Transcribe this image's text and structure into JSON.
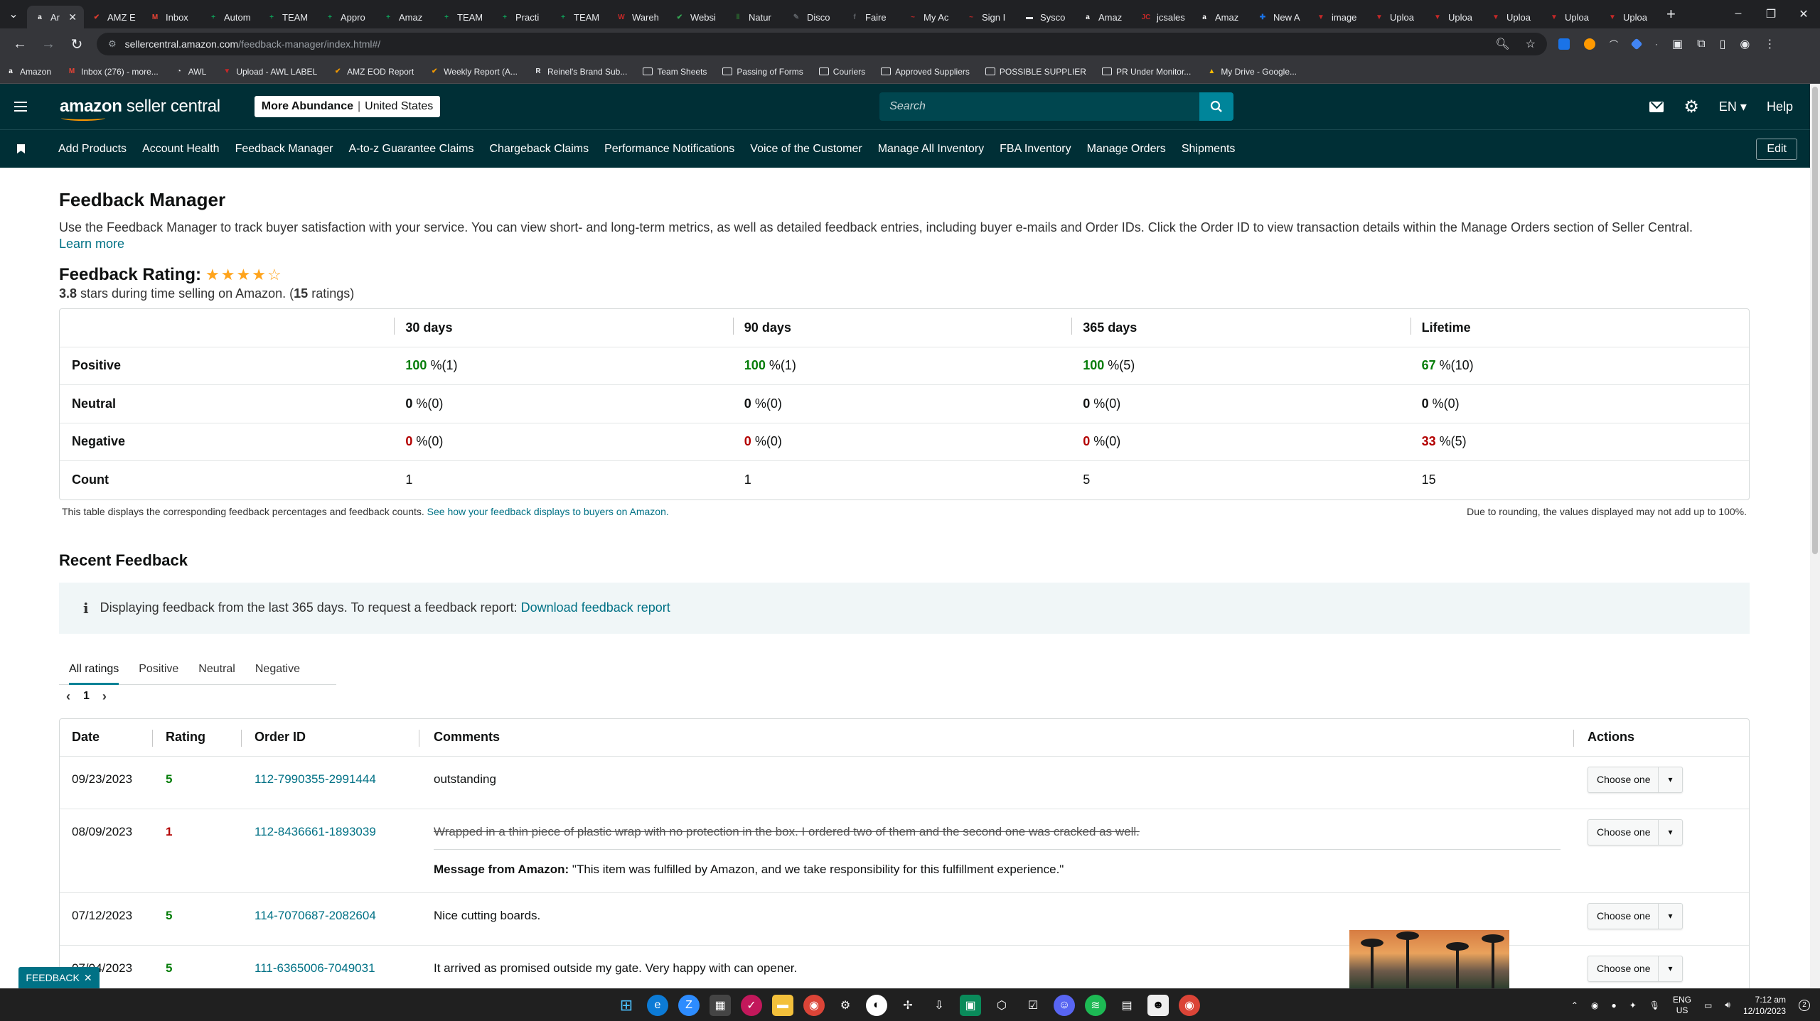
{
  "browser": {
    "tabs": [
      {
        "label": "Ar",
        "fav": "a",
        "color": "#ffffff",
        "active": true
      },
      {
        "label": "AMZ E",
        "fav": "✔",
        "color": "#e23b2e"
      },
      {
        "label": "Inbox",
        "fav": "M",
        "color": "#ea4335"
      },
      {
        "label": "Autom",
        "fav": "+",
        "color": "#0f9d58"
      },
      {
        "label": "TEAM",
        "fav": "+",
        "color": "#0f9d58"
      },
      {
        "label": "Appro",
        "fav": "+",
        "color": "#0f9d58"
      },
      {
        "label": "Amaz",
        "fav": "+",
        "color": "#0f9d58"
      },
      {
        "label": "TEAM",
        "fav": "+",
        "color": "#0f9d58"
      },
      {
        "label": "Practi",
        "fav": "+",
        "color": "#0f9d58"
      },
      {
        "label": "TEAM",
        "fav": "+",
        "color": "#0f9d58"
      },
      {
        "label": "Wareh",
        "fav": "W",
        "color": "#c62828"
      },
      {
        "label": "Websi",
        "fav": "✔",
        "color": "#34a853"
      },
      {
        "label": "Natur",
        "fav": "‖",
        "color": "#2e7d32"
      },
      {
        "label": "Disco",
        "fav": "✎",
        "color": "#5f6368"
      },
      {
        "label": "Faire",
        "fav": "f",
        "color": "#5f6368"
      },
      {
        "label": "My Ac",
        "fav": "~",
        "color": "#c62828"
      },
      {
        "label": "Sign I",
        "fav": "~",
        "color": "#c62828"
      },
      {
        "label": "Sysco",
        "fav": "▬",
        "color": "#e8eaed"
      },
      {
        "label": "Amaz",
        "fav": "a",
        "color": "#ffffff"
      },
      {
        "label": "jcsales",
        "fav": "JC",
        "color": "#c62828"
      },
      {
        "label": "Amaz",
        "fav": "a",
        "color": "#ffffff"
      },
      {
        "label": "New A",
        "fav": "✚",
        "color": "#1a73e8"
      },
      {
        "label": "image",
        "fav": "▼",
        "color": "#c62828"
      },
      {
        "label": "Uploa",
        "fav": "▼",
        "color": "#c62828"
      },
      {
        "label": "Uploa",
        "fav": "▼",
        "color": "#c62828"
      },
      {
        "label": "Uploa",
        "fav": "▼",
        "color": "#c62828"
      },
      {
        "label": "Uploa",
        "fav": "▼",
        "color": "#c62828"
      },
      {
        "label": "Uploa",
        "fav": "▼",
        "color": "#c62828"
      }
    ],
    "url_host": "sellercentral.amazon.com",
    "url_path": "/feedback-manager/index.html#/",
    "bookmarks": [
      {
        "label": "Amazon",
        "type": "icon",
        "color": "#ffffff",
        "glyph": "a"
      },
      {
        "label": "Inbox (276) - more...",
        "type": "icon",
        "color": "#ea4335",
        "glyph": "M"
      },
      {
        "label": "AWL",
        "type": "icon",
        "color": "#e8eaed",
        "glyph": "◔"
      },
      {
        "label": "Upload - AWL LABEL",
        "type": "icon",
        "color": "#c62828",
        "glyph": "▼"
      },
      {
        "label": "AMZ EOD Report",
        "type": "icon",
        "color": "#f29900",
        "glyph": "✔"
      },
      {
        "label": "Weekly Report (A...",
        "type": "icon",
        "color": "#f29900",
        "glyph": "✔"
      },
      {
        "label": "Reinel's Brand Sub...",
        "type": "icon",
        "color": "#e8eaed",
        "glyph": "R"
      },
      {
        "label": "Team Sheets",
        "type": "folder"
      },
      {
        "label": "Passing of Forms",
        "type": "folder"
      },
      {
        "label": "Couriers",
        "type": "folder"
      },
      {
        "label": "Approved Suppliers",
        "type": "folder"
      },
      {
        "label": "POSSIBLE SUPPLIER",
        "type": "folder"
      },
      {
        "label": "PR Under Monitor...",
        "type": "folder"
      },
      {
        "label": "My Drive - Google...",
        "type": "icon",
        "color": "#fbbc04",
        "glyph": "▲"
      }
    ]
  },
  "header": {
    "logo_bold": "amazon",
    "logo_rest": " seller central",
    "store_name": "More Abundance",
    "marketplace": "United States",
    "search_placeholder": "Search",
    "language": "EN ▾",
    "help": "Help"
  },
  "nav": {
    "links": [
      "Add Products",
      "Account Health",
      "Feedback Manager",
      "A-to-z Guarantee Claims",
      "Chargeback Claims",
      "Performance Notifications",
      "Voice of the Customer",
      "Manage All Inventory",
      "FBA Inventory",
      "Manage Orders",
      "Shipments"
    ],
    "edit": "Edit"
  },
  "page": {
    "title": "Feedback Manager",
    "intro": "Use the Feedback Manager to track buyer satisfaction with your service. You can view short- and long-term metrics, as well as detailed feedback entries, including buyer e-mails and Order IDs. Click the Order ID to view transaction details within the Manage Orders section of Seller Central.",
    "learn_more": "Learn more",
    "rating_title": "Feedback Rating:",
    "stars": 3.8,
    "rating_value": "3.8",
    "rating_text_a": " stars during time selling on Amazon. (",
    "rating_count": "15",
    "rating_text_b": " ratings)"
  },
  "metrics": {
    "columns": [
      "30 days",
      "90 days",
      "365 days",
      "Lifetime"
    ],
    "rows": [
      {
        "label": "Positive",
        "kind": "pos",
        "cells": [
          {
            "v": "100",
            "n": " %(1)"
          },
          {
            "v": "100",
            "n": " %(1)"
          },
          {
            "v": "100",
            "n": " %(5)"
          },
          {
            "v": "67",
            "n": " %(10)"
          }
        ]
      },
      {
        "label": "Neutral",
        "kind": "zero",
        "cells": [
          {
            "v": "0",
            "n": " %(0)"
          },
          {
            "v": "0",
            "n": " %(0)"
          },
          {
            "v": "0",
            "n": " %(0)"
          },
          {
            "v": "0",
            "n": " %(0)"
          }
        ]
      },
      {
        "label": "Negative",
        "kind": "neg",
        "cells": [
          {
            "v": "0",
            "n": " %(0)"
          },
          {
            "v": "0",
            "n": " %(0)"
          },
          {
            "v": "0",
            "n": " %(0)"
          },
          {
            "v": "33",
            "n": " %(5)"
          }
        ]
      },
      {
        "label": "Count",
        "kind": "plain",
        "cells": [
          {
            "v": "1",
            "n": ""
          },
          {
            "v": "1",
            "n": ""
          },
          {
            "v": "5",
            "n": ""
          },
          {
            "v": "15",
            "n": ""
          }
        ]
      }
    ],
    "note_left": "This table displays the corresponding feedback percentages and feedback counts.",
    "note_link": "See how your feedback displays to buyers on Amazon.",
    "note_right": "Due to rounding, the values displayed may not add up to 100%."
  },
  "recent": {
    "title": "Recent Feedback",
    "info_text": "Displaying feedback from the last 365 days. To request a feedback report:",
    "info_link": "Download feedback report",
    "tabs": [
      "All ratings",
      "Positive",
      "Neutral",
      "Negative"
    ],
    "page": "1",
    "columns": [
      "Date",
      "Rating",
      "Order ID",
      "Comments",
      "Actions"
    ],
    "action_label": "Choose one",
    "rows": [
      {
        "date": "09/23/2023",
        "rating": "5",
        "low": false,
        "order": "112-7990355-2991444",
        "comment": "outstanding",
        "struck": false,
        "amazon_label": "",
        "amazon_msg": ""
      },
      {
        "date": "08/09/2023",
        "rating": "1",
        "low": true,
        "order": "112-8436661-1893039",
        "comment": "Wrapped in a thin piece of plastic wrap with no protection in the box. I ordered two of them and the second one was cracked as well.",
        "struck": true,
        "amazon_label": "Message from Amazon:",
        "amazon_msg": " \"This item was fulfilled by Amazon, and we take responsibility for this fulfillment experience.\""
      },
      {
        "date": "07/12/2023",
        "rating": "5",
        "low": false,
        "order": "114-7070687-2082604",
        "comment": "Nice cutting boards.",
        "struck": false,
        "amazon_label": "",
        "amazon_msg": ""
      },
      {
        "date": "07/04/2023",
        "rating": "5",
        "low": false,
        "order": "111-6365006-7049031",
        "comment": "It arrived as promised outside my gate. Very happy with can opener.",
        "struck": false,
        "amazon_label": "",
        "amazon_msg": ""
      }
    ]
  },
  "feedback_widget": "FEEDBACK",
  "taskbar": {
    "lang1": "ENG",
    "lang2": "US",
    "time": "7:12 am",
    "date": "12/10/2023",
    "notif": "2"
  }
}
